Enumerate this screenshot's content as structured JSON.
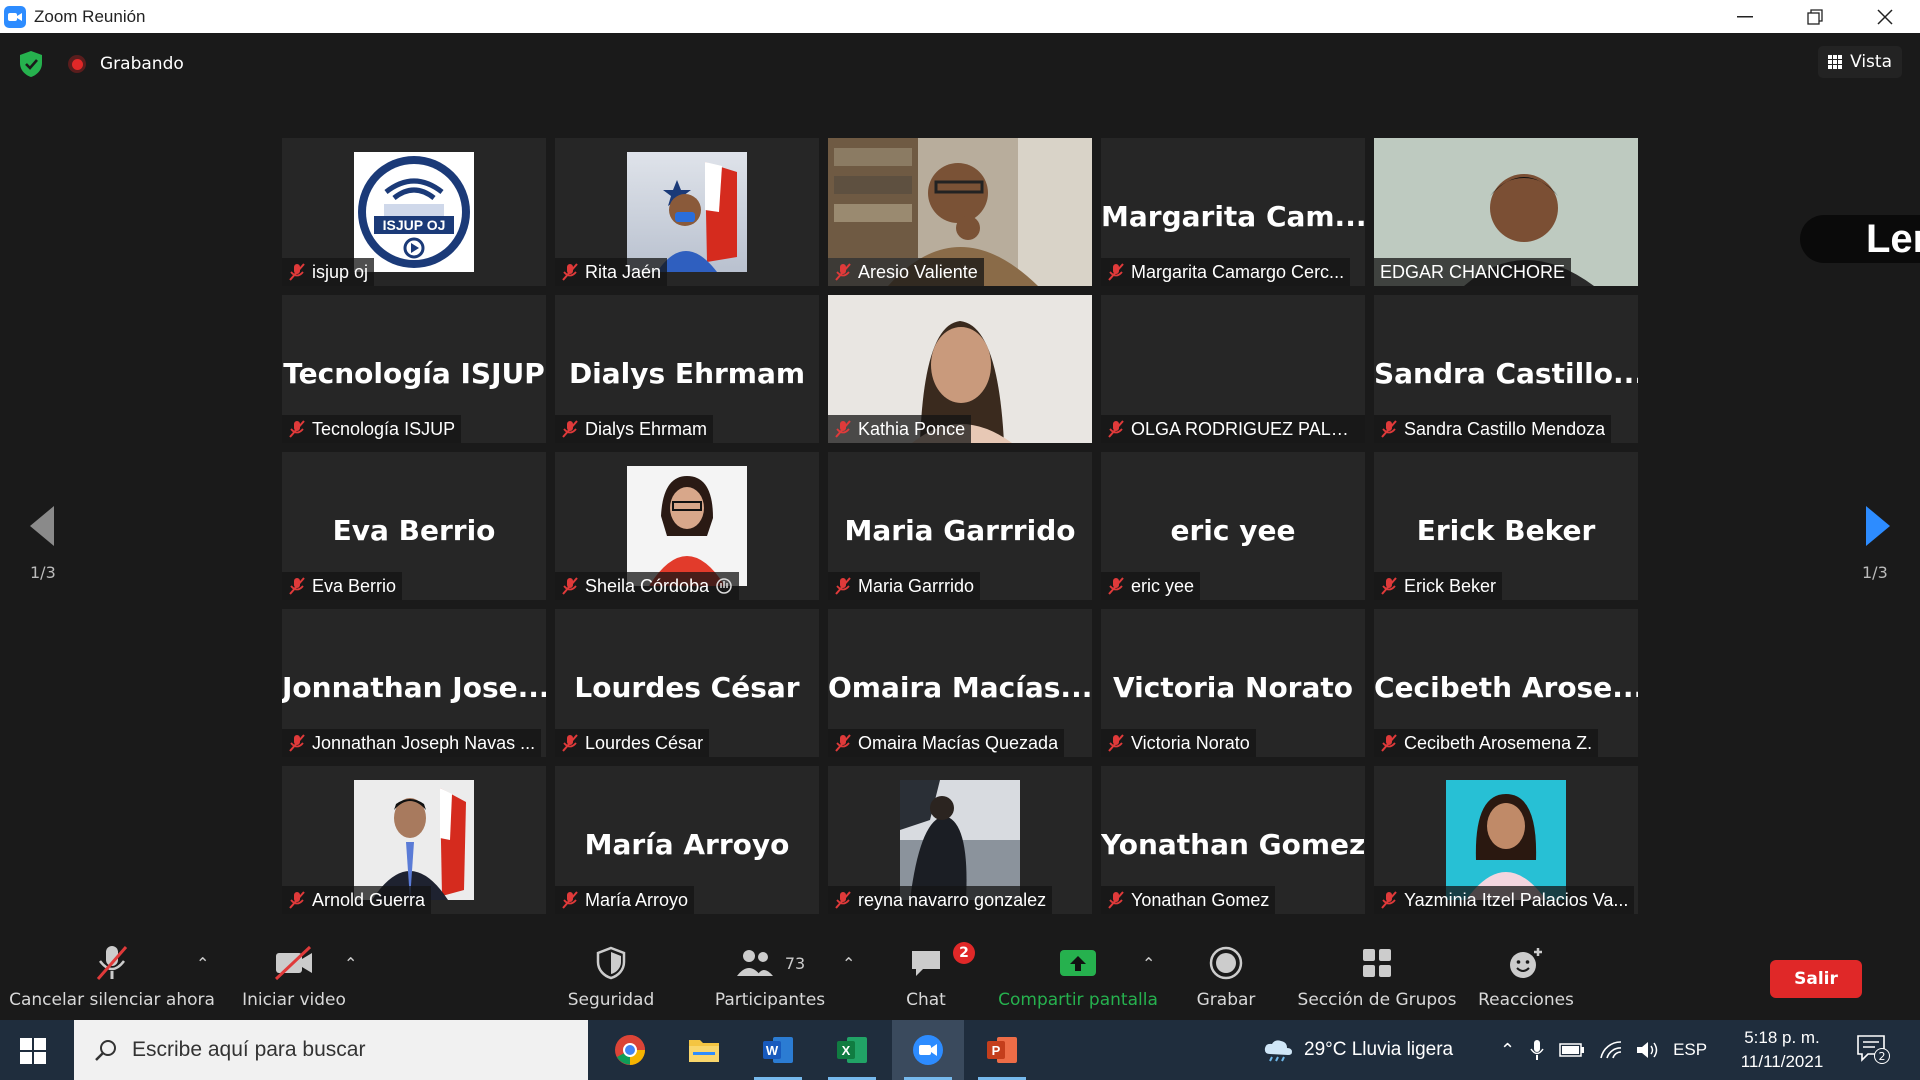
{
  "window": {
    "title": "Zoom Reunión",
    "minimize": "—",
    "restore": "❐",
    "close": "✕"
  },
  "topbar": {
    "recording_label": "Grabando",
    "view_label": "Vista"
  },
  "gallery": {
    "page_left": "1/3",
    "page_right": "1/3",
    "tiles": [
      {
        "big": "",
        "label": "isjup oj"
      },
      {
        "big": "",
        "label": "Rita Jaén"
      },
      {
        "big": "",
        "label": "Aresio Valiente"
      },
      {
        "big": "Margarita  Cam...",
        "label": "Margarita Camargo Cerc..."
      },
      {
        "big": "",
        "label": "EDGAR CHANCHORE"
      },
      {
        "big": "Tecnología ISJUP",
        "label": "Tecnología ISJUP"
      },
      {
        "big": "Dialys  Ehrmam",
        "label": "Dialys  Ehrmam"
      },
      {
        "big": "",
        "label": "Kathia Ponce"
      },
      {
        "big": "",
        "label": "OLGA RODRIGUEZ PALAC..."
      },
      {
        "big": "Sandra  Castillo...",
        "label": "Sandra Castillo Mendoza"
      },
      {
        "big": "Eva Berrio",
        "label": "Eva Berrio"
      },
      {
        "big": "",
        "label": "Sheila Córdoba"
      },
      {
        "big": "Maria Garrrido",
        "label": "Maria Garrrido"
      },
      {
        "big": "eric yee",
        "label": "eric yee"
      },
      {
        "big": "Erick Beker",
        "label": "Erick Beker"
      },
      {
        "big": "Jonnathan  Jose...",
        "label": "Jonnathan Joseph Navas ..."
      },
      {
        "big": "Lourdes César",
        "label": "Lourdes César"
      },
      {
        "big": "Omaira  Macías...",
        "label": "Omaira Macías Quezada"
      },
      {
        "big": "Victoria Norato",
        "label": "Victoria Norato"
      },
      {
        "big": "Cecibeth  Arose...",
        "label": "Cecibeth Arosemena Z."
      },
      {
        "big": "",
        "label": "Arnold Guerra"
      },
      {
        "big": "María Arroyo",
        "label": "María Arroyo"
      },
      {
        "big": "",
        "label": "reyna navarro gonzalez"
      },
      {
        "big": "Yonathan Gomez",
        "label": "Yonathan Gomez"
      },
      {
        "big": "",
        "label": "Yazminia Itzel Palacios Va..."
      }
    ],
    "logo_text": "ISJUP OJ",
    "side_brand": "Leno"
  },
  "toolbar": {
    "unmute": "Cancelar silenciar ahora",
    "video": "Iniciar video",
    "security": "Seguridad",
    "participants": "Participantes",
    "participants_count": "73",
    "chat": "Chat",
    "chat_badge": "2",
    "share": "Compartir pantalla",
    "record": "Grabar",
    "breakout": "Sección de Grupos",
    "reactions": "Reacciones",
    "leave": "Salir"
  },
  "taskbar": {
    "search_placeholder": "Escribe aquí para buscar",
    "weather": "29°C  Lluvia ligera",
    "lang": "ESP",
    "time": "5:18 p. m.",
    "date": "11/11/2021",
    "notif_count": "2"
  },
  "colors": {
    "accent_green": "#26b14e",
    "leave_red": "#e02828",
    "active_speaker": "#d4f14b",
    "mute_red": "#e03a3a"
  }
}
